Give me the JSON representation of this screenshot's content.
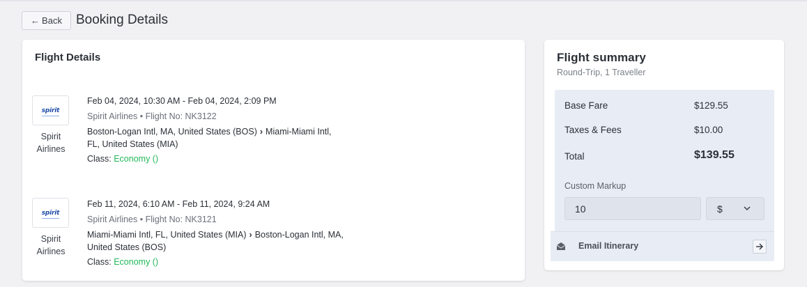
{
  "header": {
    "back_label": "Back",
    "title": "Booking Details"
  },
  "flight_details": {
    "heading": "Flight Details",
    "segments": [
      {
        "airline_logo_text": "spirit",
        "airline_name": "Spirit Airlines",
        "times": "Feb 04, 2024, 10:30 AM - Feb 04, 2024, 2:09 PM",
        "carrier": "Spirit Airlines • Flight No: NK3122",
        "route_from": "Boston-Logan Intl, MA, United States (BOS)",
        "route_to": "Miami-Miami Intl, FL, United States (MIA)",
        "class_label": "Class:",
        "class_value": "Economy ()"
      },
      {
        "airline_logo_text": "spirit",
        "airline_name": "Spirit Airlines",
        "times": "Feb 11, 2024, 6:10 AM - Feb 11, 2024, 9:24 AM",
        "carrier": "Spirit Airlines • Flight No: NK3121",
        "route_from": "Miami-Miami Intl, FL, United States (MIA)",
        "route_to": "Boston-Logan Intl, MA, United States (BOS)",
        "class_label": "Class:",
        "class_value": "Economy ()"
      }
    ]
  },
  "summary": {
    "title": "Flight summary",
    "subtitle": "Round-Trip, 1 Traveller",
    "base_fare_label": "Base Fare",
    "base_fare_value": "$129.55",
    "taxes_label": "Taxes & Fees",
    "taxes_value": "$10.00",
    "total_label": "Total",
    "total_value": "$139.55",
    "markup_label": "Custom Markup",
    "markup_value": "10",
    "currency_selected": "$",
    "email_label": "Email Itinerary"
  },
  "colors": {
    "accent_green": "#22b85a",
    "panel_bg": "#e8edf5",
    "page_bg": "#f1f1f4"
  },
  "icons": [
    "arrow-left-icon",
    "chevron-right-icon",
    "chevron-down-icon",
    "envelope-icon",
    "arrow-right-icon",
    "spirit-logo"
  ]
}
